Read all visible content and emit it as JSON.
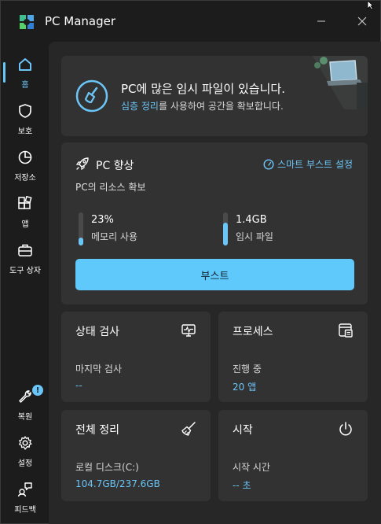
{
  "app": {
    "title": "PC Manager"
  },
  "sidebar": {
    "items": [
      {
        "label": "홈",
        "icon": "home-icon",
        "active": true
      },
      {
        "label": "보호",
        "icon": "shield-icon"
      },
      {
        "label": "저장소",
        "icon": "pie-chart-icon"
      },
      {
        "label": "앱",
        "icon": "apps-icon"
      },
      {
        "label": "도구 상자",
        "icon": "toolbox-icon"
      },
      {
        "label": "복원",
        "icon": "wrench-icon",
        "badge": "!"
      },
      {
        "label": "설정",
        "icon": "gear-icon"
      },
      {
        "label": "피드백",
        "icon": "feedback-icon"
      }
    ]
  },
  "banner": {
    "title": "PC에 많은 임시 파일이 있습니다.",
    "sub_link": "심층 정리",
    "sub_rest": "를 사용하여 공간을 확보합니다."
  },
  "boost": {
    "title": "PC 향상",
    "smart_link": "스마트 부스트 설정",
    "desc": "PC의 리소스 확보",
    "memory": {
      "value": "23%",
      "label": "메모리 사용",
      "level": 0.23
    },
    "temp": {
      "value": "1.4GB",
      "label": "임시 파일",
      "level": 0.7
    },
    "button": "부스트"
  },
  "tiles": {
    "health": {
      "title": "상태 검사",
      "label": "마지막 검사",
      "value": "--"
    },
    "process": {
      "title": "프로세스",
      "label": "진행 중",
      "value": "20 앱"
    },
    "cleanup": {
      "title": "전체 정리",
      "label": "로컬 디스크(C:)",
      "value": "104.7GB/237.6GB"
    },
    "startup": {
      "title": "시작",
      "label": "시작 시간",
      "value": "-- 초"
    }
  },
  "colors": {
    "accent": "#6cc5f7",
    "button": "#60c9fb",
    "card": "#323232",
    "panel": "#272727",
    "background": "#1c1c1c"
  }
}
